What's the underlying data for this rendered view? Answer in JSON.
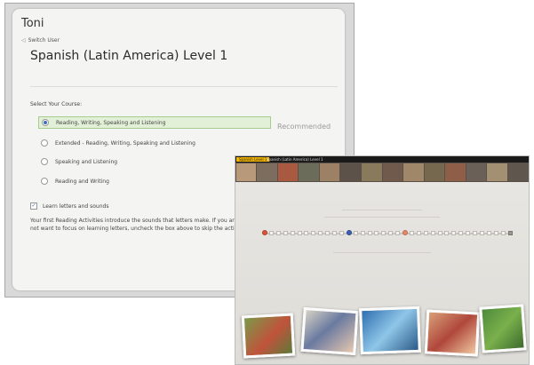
{
  "settings": {
    "user_name": "Toni",
    "switch_user": "Switch User",
    "course_title": "Spanish (Latin America) Level 1",
    "select_label": "Select Your Course:",
    "options": [
      {
        "label": "Reading, Writing, Speaking and Listening",
        "selected": true
      },
      {
        "label": "Extended - Reading, Writing, Speaking and Listening",
        "selected": false
      },
      {
        "label": "Speaking and Listening",
        "selected": false
      },
      {
        "label": "Reading and Writing",
        "selected": false
      }
    ],
    "recommended": "Recommended",
    "letters_checkbox": {
      "label": "Learn letters and sounds",
      "checked": true
    },
    "description": "Your first Reading Activities introduce the sounds that letters make. If you are comfortable with this material, or do not want to focus on learning letters, uncheck the box above to skip the activities on letters and sounds."
  },
  "lesson_screen": {
    "level_badge": "Spanish Level 1",
    "level_title": "Spanish (Latin America) Level 1",
    "colors": {
      "accent": "#f0b400",
      "current": "#3a5fb5",
      "done": "#d9553a"
    }
  }
}
